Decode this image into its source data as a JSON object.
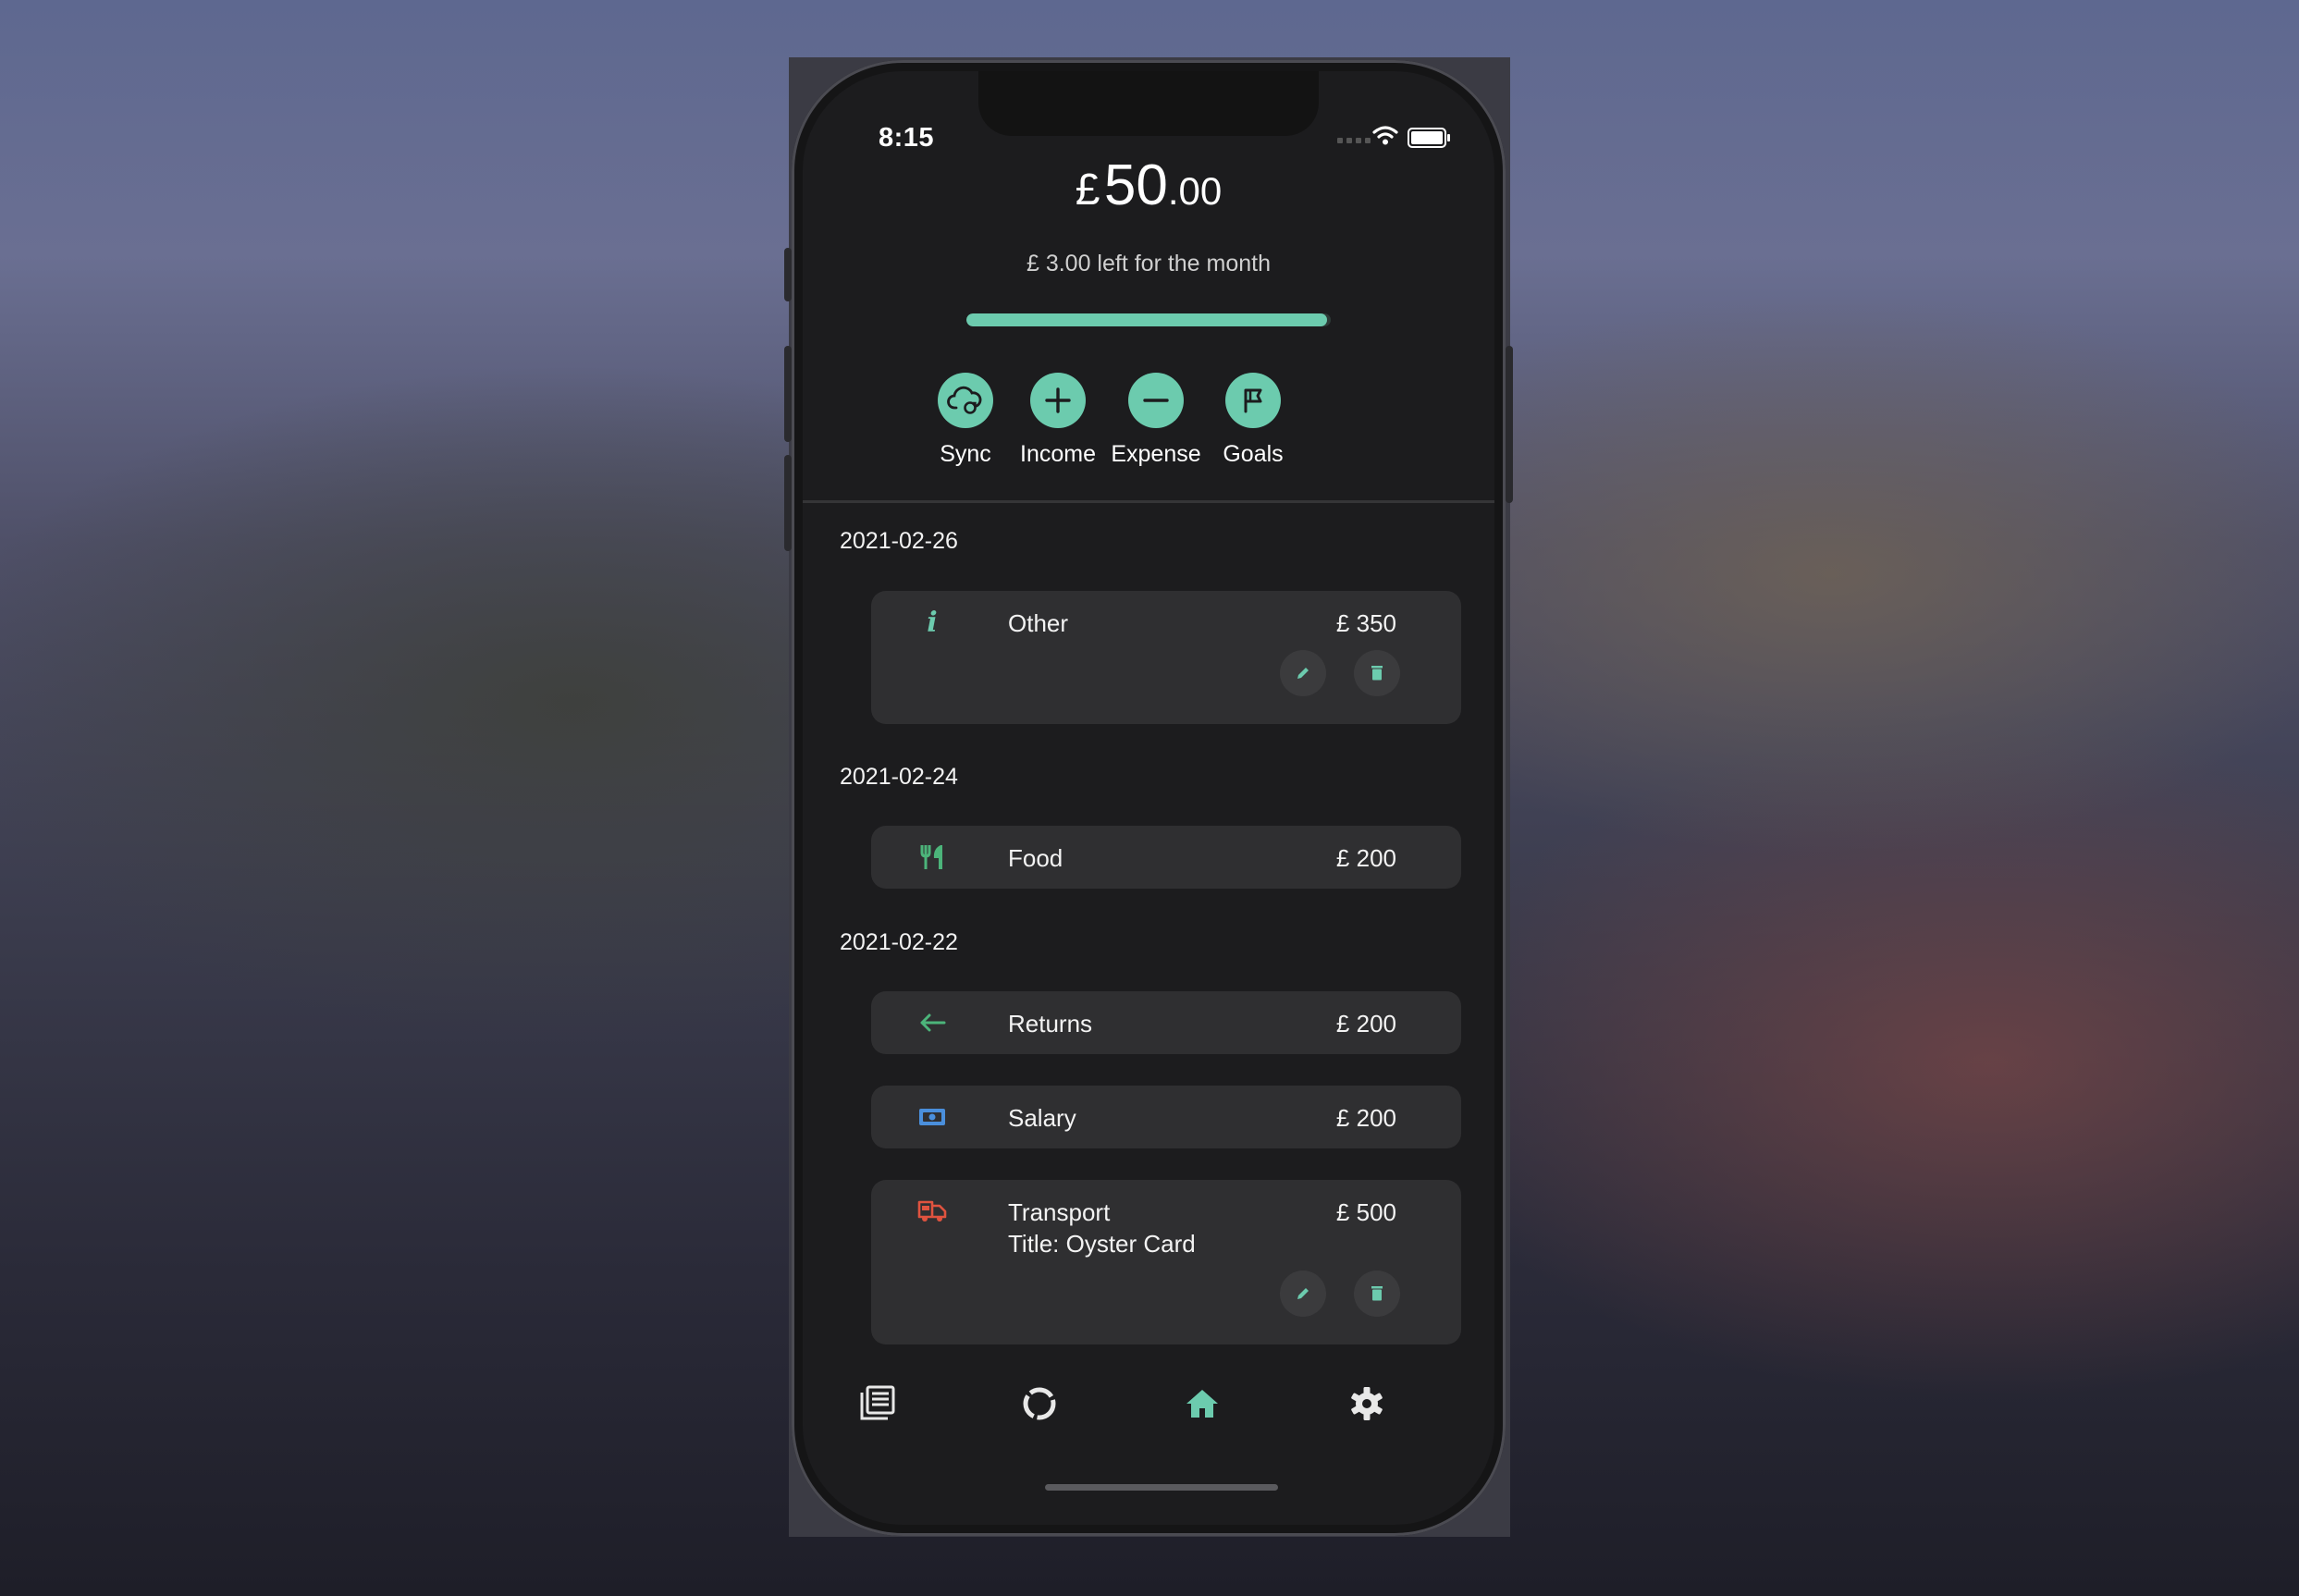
{
  "status": {
    "time": "8:15"
  },
  "balance": {
    "currency": "£",
    "whole": "50",
    "decimal": ".00"
  },
  "remaining_text": "£ 3.00 left for the month",
  "progress_fraction": 0.99,
  "accent": "#6ccbae",
  "actions": [
    {
      "label": "Sync",
      "icon": "cloud-sync-icon"
    },
    {
      "label": "Income",
      "icon": "plus-icon"
    },
    {
      "label": "Expense",
      "icon": "minus-icon"
    },
    {
      "label": "Goals",
      "icon": "flag-icon"
    }
  ],
  "groups": [
    {
      "date": "2021-02-26",
      "items": [
        {
          "category": "Other",
          "amount": "£ 350",
          "icon": "info-icon",
          "icon_color": "#6ccbae"
        }
      ]
    },
    {
      "date": "2021-02-24",
      "items": [
        {
          "category": "Food",
          "amount": "£ 200",
          "icon": "cutlery-icon",
          "icon_color": "#4cb47a"
        }
      ]
    },
    {
      "date": "2021-02-22",
      "items": [
        {
          "category": "Returns",
          "amount": "£ 200",
          "icon": "arrow-left-icon",
          "icon_color": "#4cb47a"
        },
        {
          "category": "Salary",
          "amount": "£ 200",
          "icon": "banknote-icon",
          "icon_color": "#4a8fdc"
        },
        {
          "category": "Transport",
          "subtitle": "Title: Oyster Card",
          "amount": "£ 500",
          "icon": "bus-icon",
          "icon_color": "#e0533f"
        }
      ]
    }
  ],
  "nav": [
    {
      "icon": "news-icon",
      "active": false
    },
    {
      "icon": "chart-donut-icon",
      "active": false
    },
    {
      "icon": "home-icon",
      "active": true
    },
    {
      "icon": "settings-icon",
      "active": false
    }
  ]
}
